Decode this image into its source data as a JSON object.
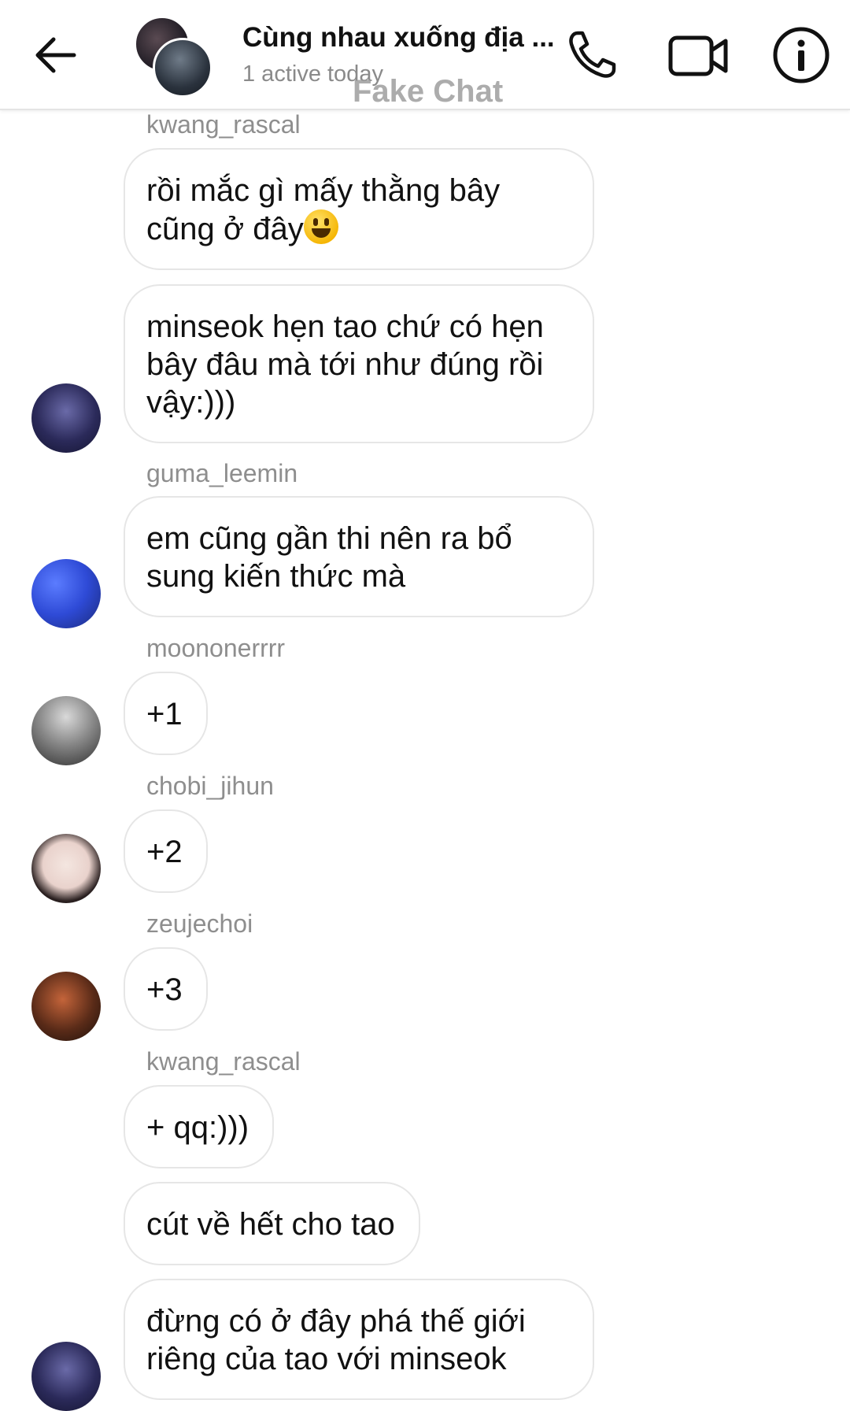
{
  "header": {
    "title": "Cùng nhau xuống địa ...",
    "subtitle": "1 active today",
    "watermark": "Fake Chat",
    "icons": {
      "back": "arrow-left-icon",
      "call": "phone-icon",
      "video": "video-camera-icon",
      "info": "info-icon"
    }
  },
  "messages": [
    {
      "sender": "kwang_rascal",
      "text": "rồi mắc gì mấy thằng bây\ncũng ở đây",
      "emoji": "grinning-face-emoji"
    },
    {
      "sender": "",
      "text": "minseok hẹn tao chứ có hẹn\nbây đâu mà tới như đúng rồi\nvậy:)))"
    },
    {
      "sender": "guma_leemin",
      "text": "em cũng gần thi nên ra bổ\nsung kiến thức mà"
    },
    {
      "sender": "moononerrrr",
      "text": "+1"
    },
    {
      "sender": "chobi_jihun",
      "text": "+2"
    },
    {
      "sender": "zeujechoi",
      "text": "+3"
    },
    {
      "sender": "kwang_rascal",
      "text": "+ qq:)))"
    },
    {
      "sender": "",
      "text": "cút về hết cho tao"
    },
    {
      "sender": "",
      "text": "đừng có ở đây phá thế giới\nriêng của tao với minseok"
    }
  ]
}
